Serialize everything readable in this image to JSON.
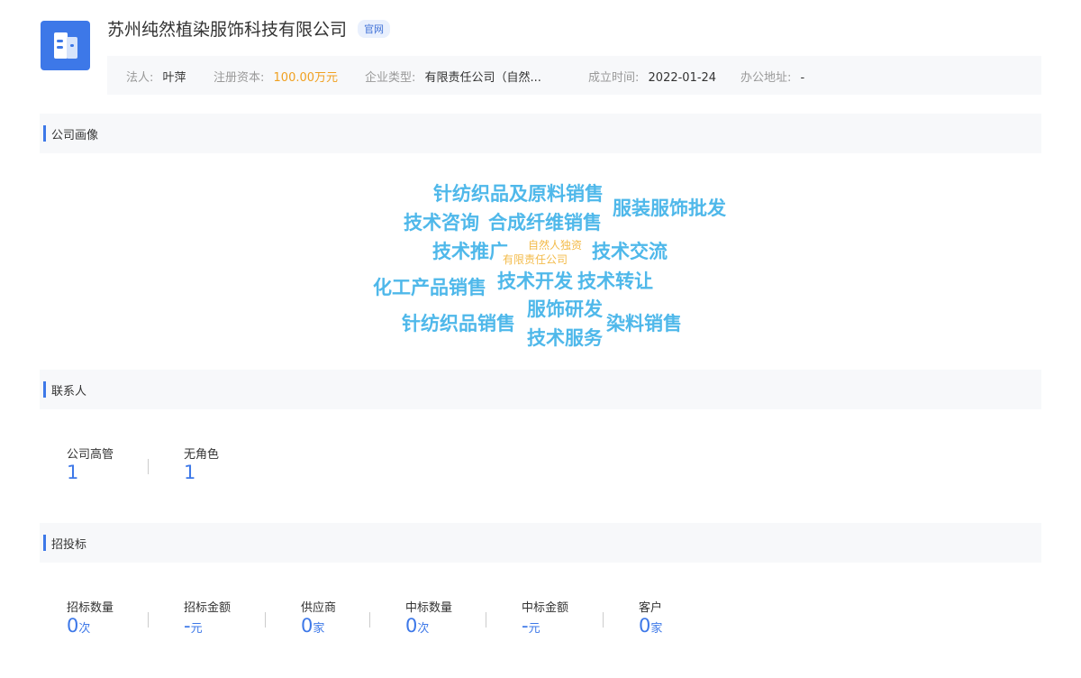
{
  "company": {
    "name": "苏州纯然植染服饰科技有限公司",
    "tag": "官网"
  },
  "info": {
    "legal_label": "法人:",
    "legal_value": "叶萍",
    "capital_label": "注册资本:",
    "capital_value": "100.00万元",
    "type_label": "企业类型:",
    "type_value": "有限责任公司（自然...",
    "date_label": "成立时间:",
    "date_value": "2022-01-24",
    "address_label": "办公地址:",
    "address_value": "-"
  },
  "sections": {
    "portrait": "公司画像",
    "contacts": "联系人",
    "bidding": "招投标"
  },
  "word_cloud": [
    "针纺织品及原料销售",
    "服装服饰批发",
    "技术咨询",
    "合成纤维销售",
    "技术推广",
    "自然人独资",
    "有限责任公司",
    "技术交流",
    "化工产品销售",
    "技术开发",
    "技术转让",
    "服饰研发",
    "针纺织品销售",
    "染料销售",
    "技术服务"
  ],
  "contacts": [
    {
      "label": "公司高管",
      "value": "1"
    },
    {
      "label": "无角色",
      "value": "1"
    }
  ],
  "bidding": [
    {
      "label": "招标数量",
      "value": "0",
      "unit": "次"
    },
    {
      "label": "招标金额",
      "value": "-",
      "unit": "元"
    },
    {
      "label": "供应商",
      "value": "0",
      "unit": "家"
    },
    {
      "label": "中标数量",
      "value": "0",
      "unit": "次"
    },
    {
      "label": "中标金额",
      "value": "-",
      "unit": "元"
    },
    {
      "label": "客户",
      "value": "0",
      "unit": "家"
    }
  ],
  "colors": {
    "accent": "#3d78e8",
    "cloud_primary": "#4fb8ea",
    "cloud_secondary": "#f3bb4a",
    "capital": "#f0a020"
  }
}
